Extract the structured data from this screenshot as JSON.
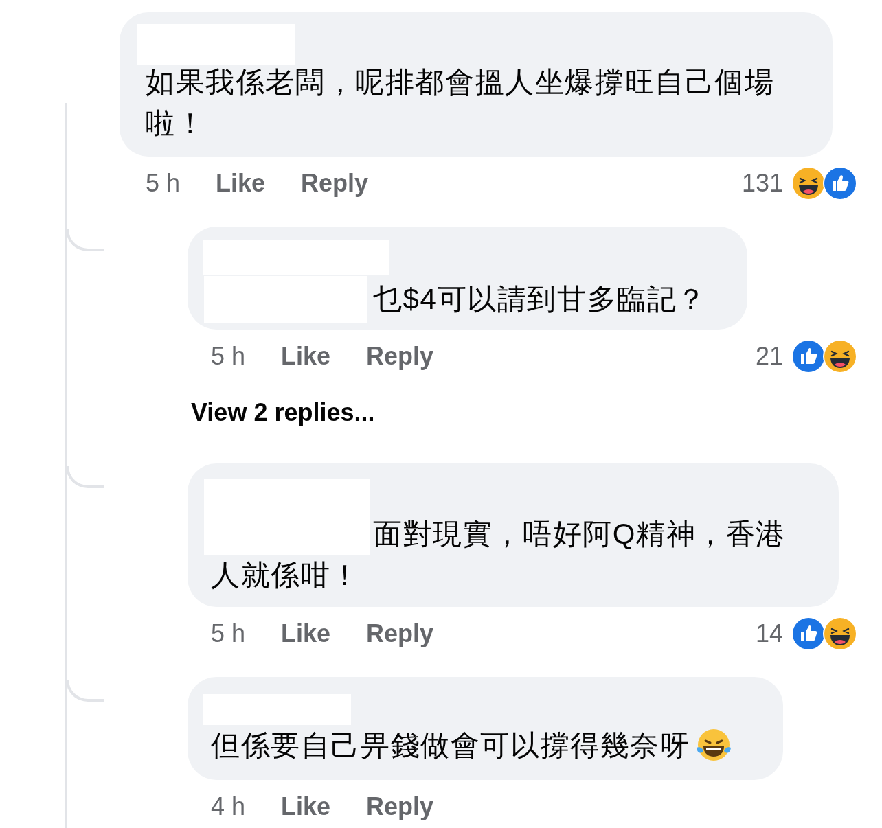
{
  "comment": {
    "text": "如果我係老闆，呢排都會搵人坐爆撐旺自己個場啦！",
    "time": "5 h",
    "like": "Like",
    "reply": "Reply",
    "reaction_count": "131",
    "reactions": [
      {
        "kind": "haha"
      },
      {
        "kind": "like"
      }
    ]
  },
  "replies": [
    {
      "kind": "comment",
      "text": "乜$4可以請到甘多臨記？",
      "time": "5 h",
      "like": "Like",
      "reply": "Reply",
      "reaction_count": "21",
      "reactions": [
        {
          "kind": "like"
        },
        {
          "kind": "haha"
        }
      ]
    },
    {
      "kind": "more",
      "label": "View 2 replies..."
    },
    {
      "kind": "comment",
      "text": "面對現實，唔好阿Q精神，香港人就係咁！",
      "time": "5 h",
      "like": "Like",
      "reply": "Reply",
      "reaction_count": "14",
      "reactions": [
        {
          "kind": "like"
        },
        {
          "kind": "haha"
        }
      ]
    },
    {
      "kind": "comment",
      "text": "但係要自己畀錢做會可以撐得幾奈呀",
      "ends_with_emoji": true,
      "time": "4 h",
      "like": "Like",
      "reply": "Reply"
    }
  ]
}
